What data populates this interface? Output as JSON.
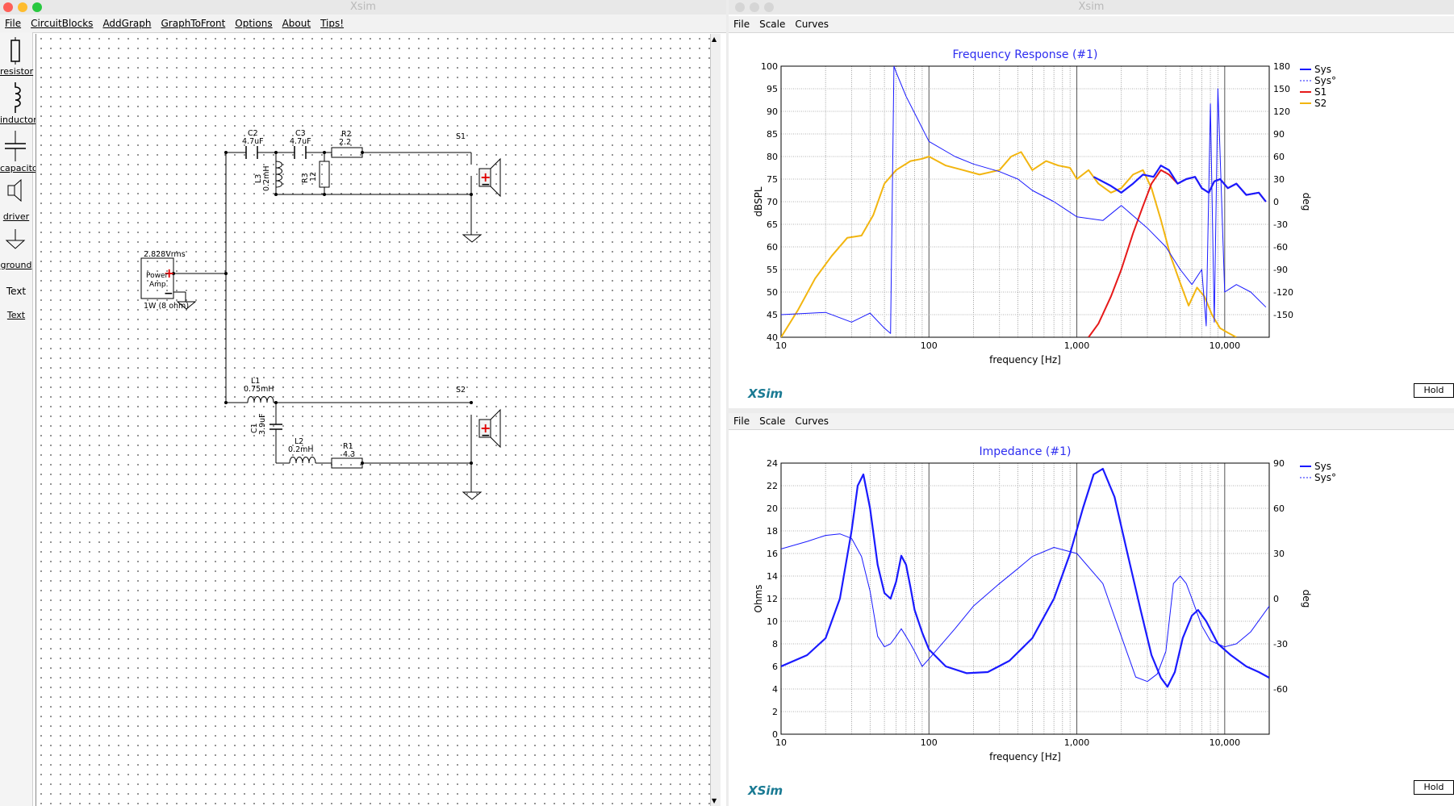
{
  "left_window": {
    "title": "Xsim",
    "menu": [
      "File",
      "CircuitBlocks",
      "AddGraph",
      "GraphToFront",
      "Options",
      "About",
      "Tips!"
    ],
    "palette": [
      {
        "label": "resistor",
        "icon": "resistor-icon"
      },
      {
        "label": "inductor",
        "icon": "inductor-icon"
      },
      {
        "label": "capacitor",
        "icon": "capacitor-icon"
      },
      {
        "label": "driver",
        "icon": "driver-icon"
      },
      {
        "label": "ground",
        "icon": "ground-icon"
      },
      {
        "label": "Text",
        "icon": "text-icon"
      },
      {
        "label": "Text",
        "icon": ""
      }
    ],
    "circuit": {
      "source_voltage": "2.828Vrms",
      "source_name": "Power\nAmp.",
      "source_label_1": "Power",
      "source_label_2": "Amp.",
      "source_note": "1W (8 ohm)",
      "C2": {
        "name": "C2",
        "value": "4.7uF"
      },
      "C3": {
        "name": "C3",
        "value": "4.7uF"
      },
      "R2": {
        "name": "R2",
        "value": "2.2"
      },
      "L3": {
        "name": "L3",
        "value": "0.2mH"
      },
      "R3": {
        "name": "R3",
        "value": "12"
      },
      "S1": "S1",
      "S2": "S2",
      "L1": {
        "name": "L1",
        "value": "0.75mH"
      },
      "C1": {
        "name": "C1",
        "value": "3.9uF"
      },
      "L2": {
        "name": "L2",
        "value": "0.2mH"
      },
      "R1": {
        "name": "R1",
        "value": "4.3"
      }
    }
  },
  "right_window": {
    "title": "Xsim",
    "menu": [
      "File",
      "Scale",
      "Curves"
    ],
    "menu2": [
      "File",
      "Scale",
      "Curves"
    ],
    "hold_label": "Hold",
    "brand": "XSim"
  },
  "colors": {
    "sys": "#1a1aff",
    "s1": "#e61919",
    "s2": "#f2b50f",
    "title": "#2d2df0",
    "brand": "#1a7a93"
  },
  "chart_data": [
    {
      "type": "line",
      "title": "Frequency Response (#1)",
      "xlabel": "frequency [Hz]",
      "ylabel": "dBSPL",
      "y2label": "deg",
      "x_scale": "log",
      "xlim": [
        10,
        20000
      ],
      "ylim": [
        40,
        100
      ],
      "y2lim": [
        -180,
        180
      ],
      "x_ticks": [
        "10",
        "100",
        "1,000",
        "10,000"
      ],
      "y_ticks": [
        "40",
        "45",
        "50",
        "55",
        "60",
        "65",
        "70",
        "75",
        "80",
        "85",
        "90",
        "95",
        "100"
      ],
      "y2_ticks": [
        "-150",
        "-120",
        "-90",
        "-60",
        "-30",
        "0",
        "30",
        "60",
        "90",
        "120",
        "150",
        "180"
      ],
      "grid": true,
      "legend_position": "right",
      "series": [
        {
          "name": "Sys",
          "axis": "left",
          "style": "solid",
          "color": "#1a1aff",
          "x": [
            1300,
            1700,
            2000,
            2400,
            2800,
            3300,
            3700,
            4200,
            4800,
            5500,
            6300,
            7000,
            7800,
            8500,
            9300,
            10500,
            12000,
            14000,
            17000,
            19000
          ],
          "y": [
            75.5,
            73.5,
            72,
            74,
            76,
            75.5,
            78,
            77,
            74,
            75,
            75.5,
            73,
            72,
            74.5,
            75,
            73,
            74,
            71.5,
            72,
            70
          ]
        },
        {
          "name": "Sys°",
          "axis": "right",
          "style": "dashed",
          "color": "#1a1aff",
          "x": [
            10,
            20,
            30,
            40,
            50,
            55,
            58,
            60,
            70,
            100,
            150,
            200,
            300,
            400,
            500,
            700,
            1000,
            1500,
            2000,
            3000,
            4000,
            5000,
            6000,
            7000,
            7500,
            8000,
            8500,
            9000,
            10000,
            12000,
            15000,
            19000
          ],
          "y": [
            -150,
            -147,
            -160,
            -148,
            -168,
            -175,
            180,
            172,
            140,
            80,
            60,
            50,
            40,
            30,
            15,
            0,
            -20,
            -25,
            -5,
            -35,
            -60,
            -90,
            -110,
            -90,
            -165,
            130,
            -160,
            150,
            -120,
            -110,
            -120,
            -140
          ]
        },
        {
          "name": "S1",
          "axis": "left",
          "style": "solid",
          "color": "#e61919",
          "x": [
            1200,
            1400,
            1700,
            2000,
            2400,
            2800,
            3200,
            3700,
            4200,
            4800,
            5500,
            6300,
            7000,
            7800,
            8500,
            9300,
            10500,
            12000,
            14000,
            17000,
            19000
          ],
          "y": [
            40,
            43,
            49,
            55,
            63,
            69,
            74,
            77,
            76,
            74,
            75,
            75.5,
            73,
            72,
            74.5,
            75,
            73,
            74,
            71.5,
            72,
            70
          ]
        },
        {
          "name": "S2",
          "axis": "left",
          "style": "solid",
          "color": "#f2b50f",
          "x": [
            10,
            13,
            17,
            22,
            28,
            35,
            42,
            50,
            60,
            75,
            90,
            100,
            130,
            170,
            220,
            300,
            360,
            420,
            500,
            620,
            750,
            900,
            1000,
            1200,
            1400,
            1700,
            2000,
            2400,
            2800,
            3200,
            3700,
            4300,
            5000,
            5700,
            6500,
            7300,
            8200,
            9300,
            10500,
            12000
          ],
          "y": [
            40,
            46,
            53,
            58,
            62,
            62.5,
            67,
            74,
            77,
            79,
            79.5,
            80,
            78,
            77,
            76,
            77,
            80,
            81,
            77,
            79,
            78,
            77.5,
            75,
            77,
            74,
            72,
            73,
            76,
            77,
            73,
            66,
            58,
            52,
            47,
            51,
            49,
            45,
            42,
            41,
            40
          ]
        }
      ]
    },
    {
      "type": "line",
      "title": "Impedance (#1)",
      "xlabel": "frequency [Hz]",
      "ylabel": "Ohms",
      "y2label": "deg",
      "x_scale": "log",
      "xlim": [
        10,
        20000
      ],
      "ylim": [
        0,
        24
      ],
      "y2lim": [
        -90,
        90
      ],
      "x_ticks": [
        "10",
        "100",
        "1,000",
        "10,000"
      ],
      "y_ticks": [
        "0",
        "2",
        "4",
        "6",
        "8",
        "10",
        "12",
        "14",
        "16",
        "18",
        "20",
        "22",
        "24"
      ],
      "y2_ticks": [
        "-60",
        "-30",
        "0",
        "30",
        "60",
        "90"
      ],
      "grid": true,
      "legend_position": "right",
      "series": [
        {
          "name": "Sys",
          "axis": "left",
          "style": "solid",
          "color": "#1a1aff",
          "x": [
            10,
            15,
            20,
            25,
            30,
            33,
            36,
            40,
            45,
            50,
            55,
            60,
            65,
            70,
            75,
            80,
            90,
            100,
            130,
            180,
            250,
            350,
            500,
            700,
            900,
            1100,
            1300,
            1500,
            1800,
            2200,
            2700,
            3200,
            3700,
            4100,
            4600,
            5200,
            6000,
            6600,
            7500,
            9000,
            11000,
            14000,
            17000,
            20000
          ],
          "y": [
            6,
            7,
            8.5,
            12,
            18,
            22,
            23,
            20,
            15,
            12.5,
            12,
            13.5,
            15.8,
            15,
            13,
            11,
            9,
            7.5,
            6,
            5.4,
            5.5,
            6.5,
            8.5,
            12,
            16,
            20,
            23,
            23.5,
            21,
            16,
            11,
            7,
            5,
            4.2,
            5.5,
            8.5,
            10.5,
            11,
            10,
            8,
            7,
            6,
            5.5,
            5
          ]
        },
        {
          "name": "Sys°",
          "axis": "right",
          "style": "dashed",
          "color": "#1a1aff",
          "x": [
            10,
            15,
            20,
            25,
            30,
            35,
            40,
            45,
            50,
            55,
            60,
            65,
            70,
            75,
            80,
            90,
            100,
            150,
            200,
            300,
            400,
            500,
            700,
            1000,
            1500,
            2000,
            2500,
            3000,
            3500,
            4000,
            4500,
            5000,
            5500,
            6000,
            7000,
            8000,
            10000,
            12000,
            15000,
            20000
          ],
          "y": [
            33,
            38,
            42,
            43,
            40,
            28,
            5,
            -25,
            -32,
            -30,
            -25,
            -20,
            -25,
            -30,
            -35,
            -45,
            -40,
            -20,
            -5,
            10,
            20,
            28,
            34,
            30,
            10,
            -25,
            -52,
            -55,
            -50,
            -35,
            10,
            15,
            10,
            0,
            -18,
            -28,
            -32,
            -30,
            -22,
            -5
          ]
        }
      ]
    }
  ]
}
